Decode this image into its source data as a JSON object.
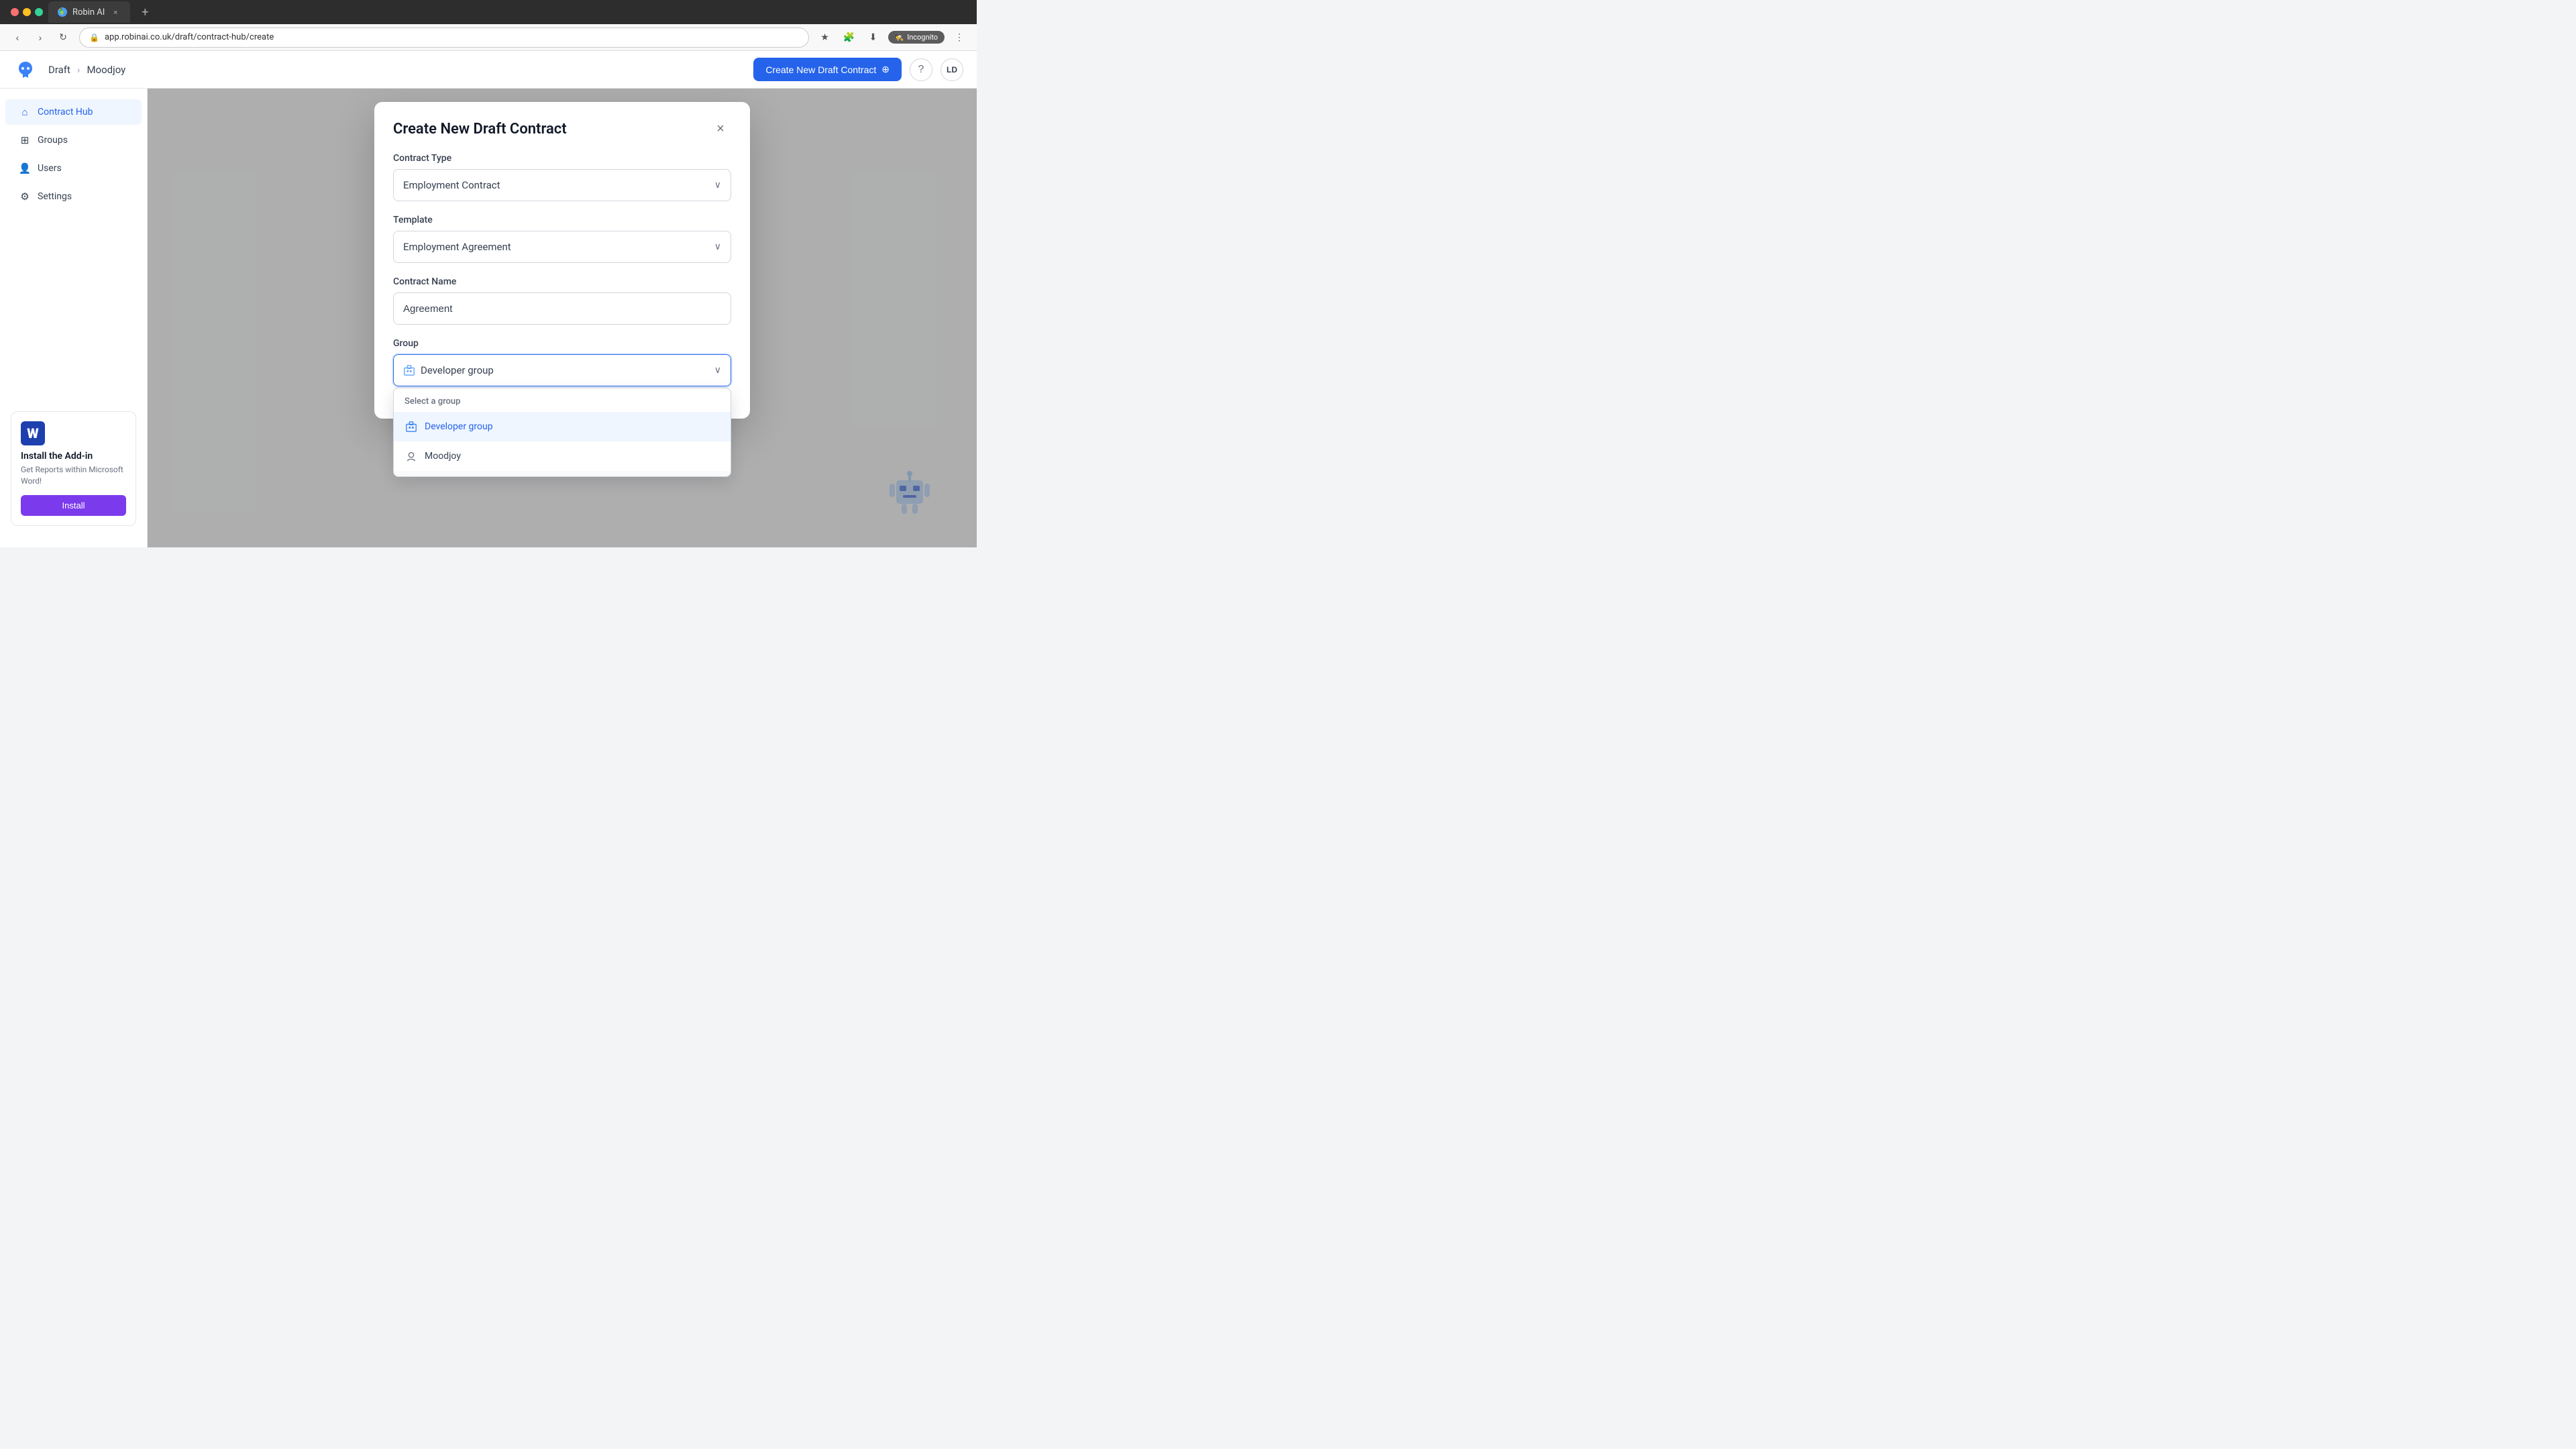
{
  "browser": {
    "tab_title": "Robin AI",
    "url": "app.robinai.co.uk/draft/contract-hub/create",
    "incognito_label": "Incognito"
  },
  "topnav": {
    "breadcrumb_draft": "Draft",
    "breadcrumb_company": "Moodjoy",
    "create_btn_label": "Create New Draft Contract",
    "help_icon": "?",
    "avatar_label": "LD"
  },
  "sidebar": {
    "items": [
      {
        "id": "contract-hub",
        "label": "Contract Hub",
        "icon": "🏠",
        "active": true
      },
      {
        "id": "groups",
        "label": "Groups",
        "icon": "⊞",
        "active": false
      },
      {
        "id": "users",
        "label": "Users",
        "icon": "👤",
        "active": false
      },
      {
        "id": "settings",
        "label": "Settings",
        "icon": "⚙",
        "active": false
      }
    ],
    "addon": {
      "title": "Install the Add-in",
      "description": "Get Reports within Microsoft Word!",
      "button_label": "Install",
      "word_icon": "W"
    }
  },
  "modal": {
    "title": "Create New Draft Contract",
    "close_icon": "×",
    "fields": {
      "contract_type": {
        "label": "Contract Type",
        "value": "Employment Contract",
        "placeholder": "Employment Contract"
      },
      "template": {
        "label": "Template",
        "value": "Employment Agreement",
        "placeholder": "Employment Agreement"
      },
      "contract_name": {
        "label": "Contract Name",
        "value": "Agreement",
        "placeholder": "Agreement"
      },
      "group": {
        "label": "Group",
        "selected_value": "Developer group",
        "dropdown_label": "Select a group",
        "options": [
          {
            "id": "developer-group",
            "label": "Developer group",
            "selected": true
          },
          {
            "id": "moodjoy",
            "label": "Moodjoy",
            "selected": false
          }
        ]
      }
    }
  },
  "icons": {
    "chevron_down": "⌄",
    "group_icon": "📋",
    "plus_icon": "+"
  }
}
